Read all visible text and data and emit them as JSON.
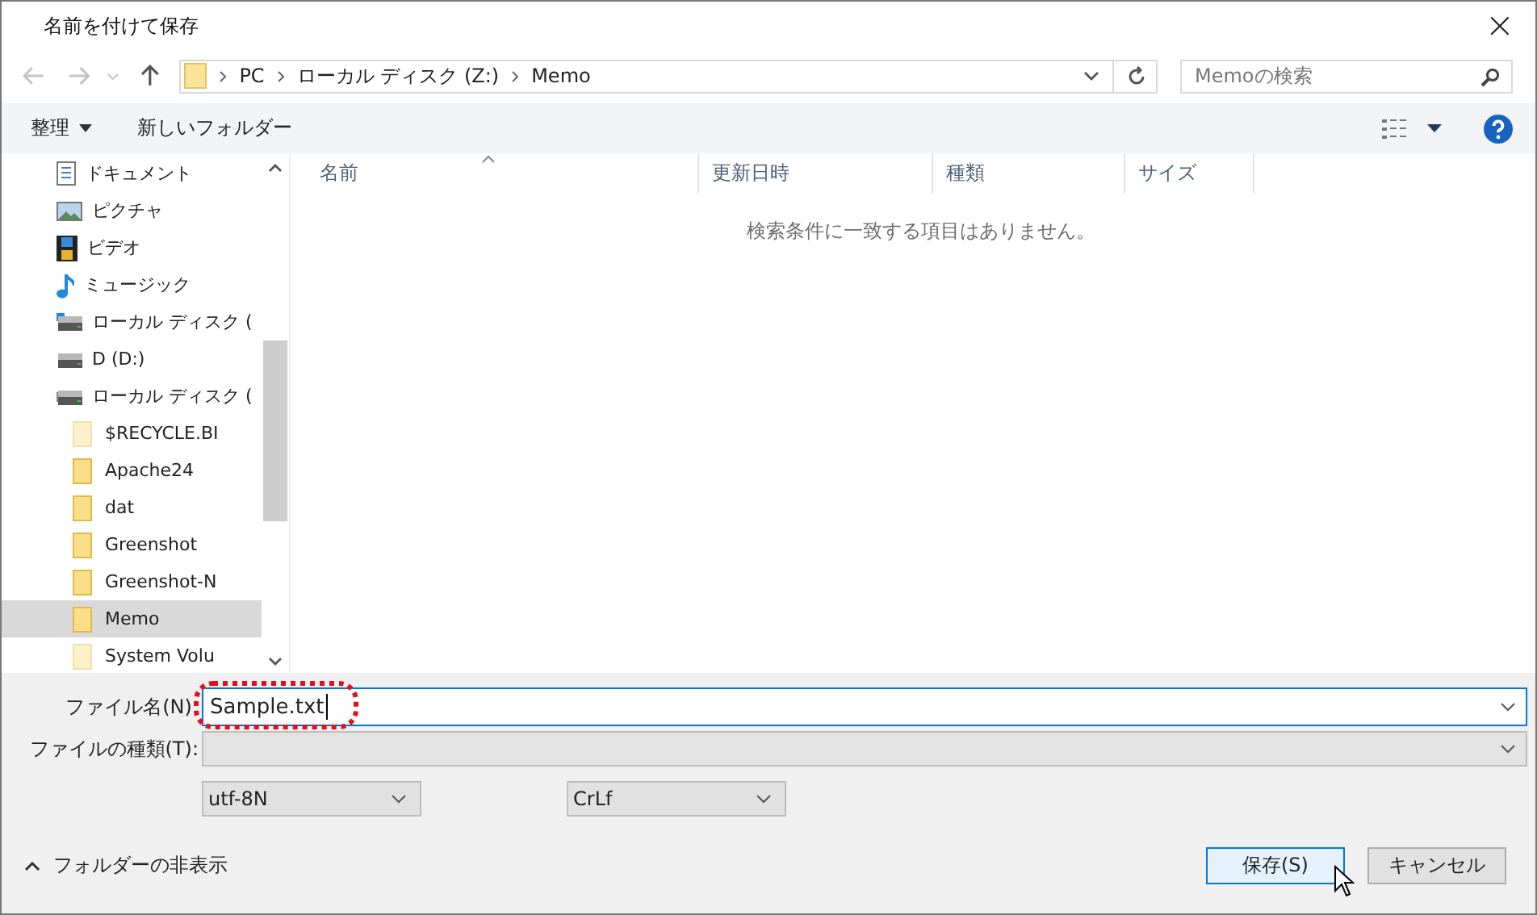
{
  "window": {
    "title": "名前を付けて保存",
    "close": "×"
  },
  "address": {
    "path": [
      "PC",
      "ローカル ディスク (Z:)",
      "Memo"
    ]
  },
  "search": {
    "placeholder": "Memoの検索"
  },
  "toolbar": {
    "organize": "整理",
    "new_folder": "新しいフォルダー"
  },
  "sidebar": {
    "items": [
      {
        "label": "ドキュメント",
        "kind": "document",
        "selected": false
      },
      {
        "label": "ピクチャ",
        "kind": "picture",
        "selected": false
      },
      {
        "label": "ビデオ",
        "kind": "video",
        "selected": false
      },
      {
        "label": "ミュージック",
        "kind": "music",
        "selected": false
      },
      {
        "label": "ローカル ディスク (",
        "kind": "drive-system",
        "selected": false
      },
      {
        "label": "D (D:)",
        "kind": "drive",
        "selected": false
      },
      {
        "label": "ローカル ディスク (",
        "kind": "drive-network",
        "selected": false,
        "children": [
          {
            "label": "$RECYCLE.BI",
            "kind": "folder-hidden",
            "selected": false
          },
          {
            "label": "Apache24",
            "kind": "folder",
            "selected": false
          },
          {
            "label": "dat",
            "kind": "folder",
            "selected": false
          },
          {
            "label": "Greenshot",
            "kind": "folder",
            "selected": false
          },
          {
            "label": "Greenshot-N",
            "kind": "folder",
            "selected": false
          },
          {
            "label": "Memo",
            "kind": "folder",
            "selected": true
          },
          {
            "label": "System Volu",
            "kind": "folder-hidden",
            "selected": false
          }
        ]
      }
    ]
  },
  "table": {
    "columns": [
      "名前",
      "更新日時",
      "種類",
      "サイズ"
    ],
    "empty_message": "検索条件に一致する項目はありません。"
  },
  "form": {
    "file_name_label": "ファイル名(N):",
    "file_name": "Sample.txt",
    "file_type_label": "ファイルの種類(T):",
    "encoding": "utf-8N",
    "line_ending": "CrLf"
  },
  "footer": {
    "hide_folders": "フォルダーの非表示",
    "buttons": [
      {
        "label": "保存(S)",
        "kind": "primary"
      },
      {
        "label": "キャンセル",
        "kind": "normal"
      }
    ]
  }
}
